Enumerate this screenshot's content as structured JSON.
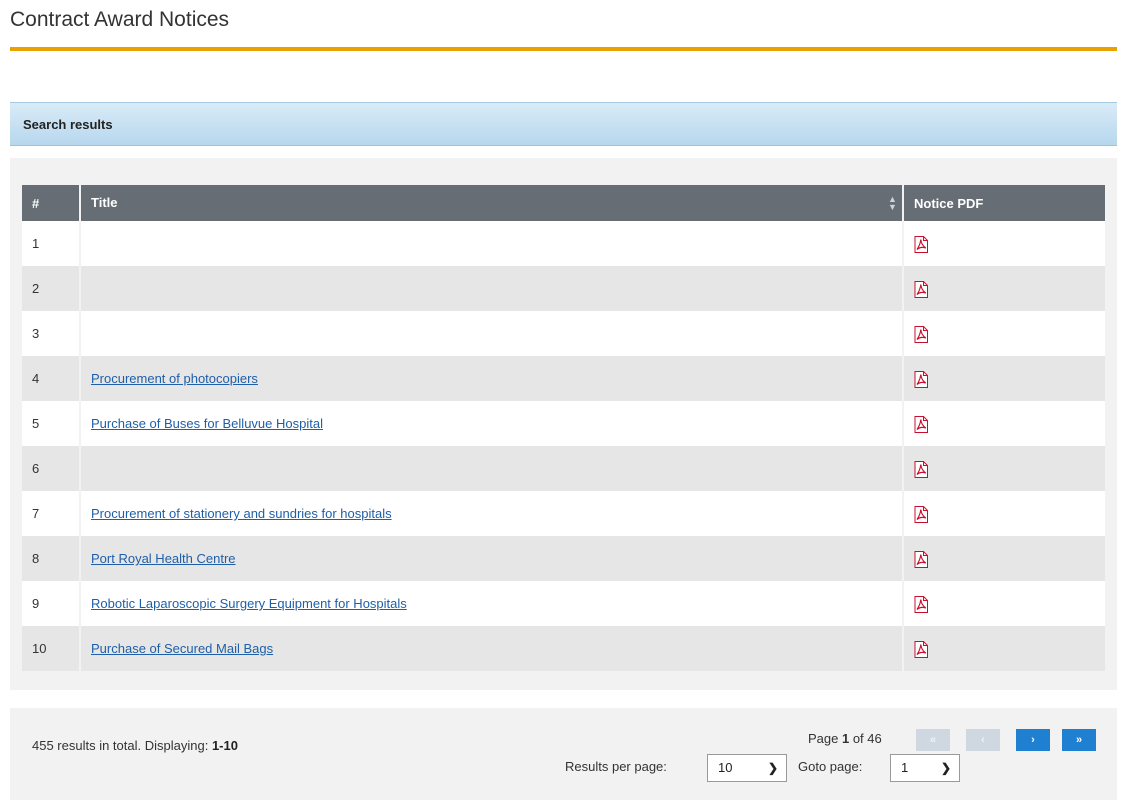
{
  "page": {
    "title": "Contract Award Notices"
  },
  "section": {
    "header": "Search results"
  },
  "table": {
    "columns": [
      "#",
      "Title",
      "Notice PDF"
    ],
    "rows": [
      {
        "num": "1",
        "title": ""
      },
      {
        "num": "2",
        "title": ""
      },
      {
        "num": "3",
        "title": ""
      },
      {
        "num": "4",
        "title": "Procurement of photocopiers"
      },
      {
        "num": "5",
        "title": "Purchase of Buses for Belluvue Hospital"
      },
      {
        "num": "6",
        "title": ""
      },
      {
        "num": "7",
        "title": "Procurement of stationery and sundries for hospitals"
      },
      {
        "num": "8",
        "title": "Port Royal Health Centre"
      },
      {
        "num": "9",
        "title": "Robotic Laparoscopic Surgery Equipment for Hospitals"
      },
      {
        "num": "10",
        "title": "Purchase of Secured Mail Bags"
      }
    ],
    "pdf_icon": "pdf-icon"
  },
  "pager": {
    "summary_prefix": "455 results in total. Displaying: ",
    "summary_range": "1-10",
    "page_word": "Page ",
    "current_page": "1",
    "of_word": " of ",
    "total_pages": "46",
    "first_label": "«",
    "prev_label": "‹",
    "next_label": "›",
    "last_label": "»",
    "results_per_page_label": "Results per page:",
    "results_per_page_value": "10",
    "goto_label": "Goto page:",
    "goto_value": "1"
  },
  "colors": {
    "accent_rule": "#e8a100",
    "header_bg": "#666d75",
    "link": "#1f5fa8",
    "nav_enabled": "#1f7fd0"
  }
}
